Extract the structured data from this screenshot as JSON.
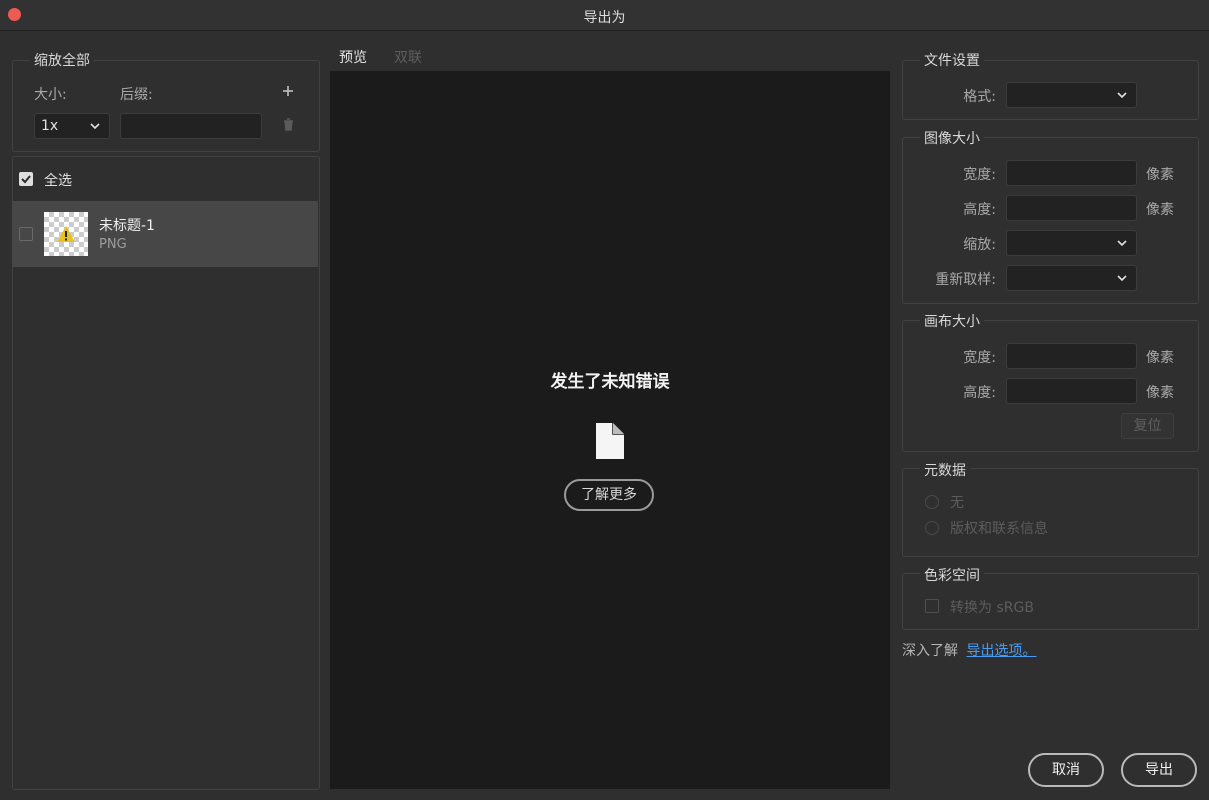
{
  "window": {
    "title": "导出为"
  },
  "scale_all": {
    "title": "缩放全部",
    "size_label": "大小:",
    "suffix_label": "后缀:",
    "size_value": "1x",
    "add_icon": "plus-icon",
    "delete_icon": "trash-icon"
  },
  "assets": {
    "select_all_label": "全选",
    "items": [
      {
        "name": "未标题-1",
        "format": "PNG"
      }
    ]
  },
  "preview": {
    "tabs": [
      {
        "label": "预览",
        "active": true
      },
      {
        "label": "双联",
        "active": false
      }
    ],
    "error_title": "发生了未知错误",
    "learn_more_label": "了解更多"
  },
  "file_settings": {
    "title": "文件设置",
    "format_label": "格式:"
  },
  "image_size": {
    "title": "图像大小",
    "width_label": "宽度:",
    "height_label": "高度:",
    "scale_label": "缩放:",
    "resample_label": "重新取样:",
    "unit": "像素"
  },
  "canvas_size": {
    "title": "画布大小",
    "width_label": "宽度:",
    "height_label": "高度:",
    "unit": "像素",
    "reset_label": "复位"
  },
  "metadata": {
    "title": "元数据",
    "options": [
      "无",
      "版权和联系信息"
    ]
  },
  "color_space": {
    "title": "色彩空间",
    "convert_label": "转换为 sRGB"
  },
  "footer": {
    "learn_prefix": "深入了解",
    "learn_link": "导出选项。",
    "cancel_label": "取消",
    "export_label": "导出"
  },
  "colors": {
    "close_button": "#ee5b53",
    "warning_yellow": "#e8c21f",
    "link": "#4a9cf2"
  }
}
